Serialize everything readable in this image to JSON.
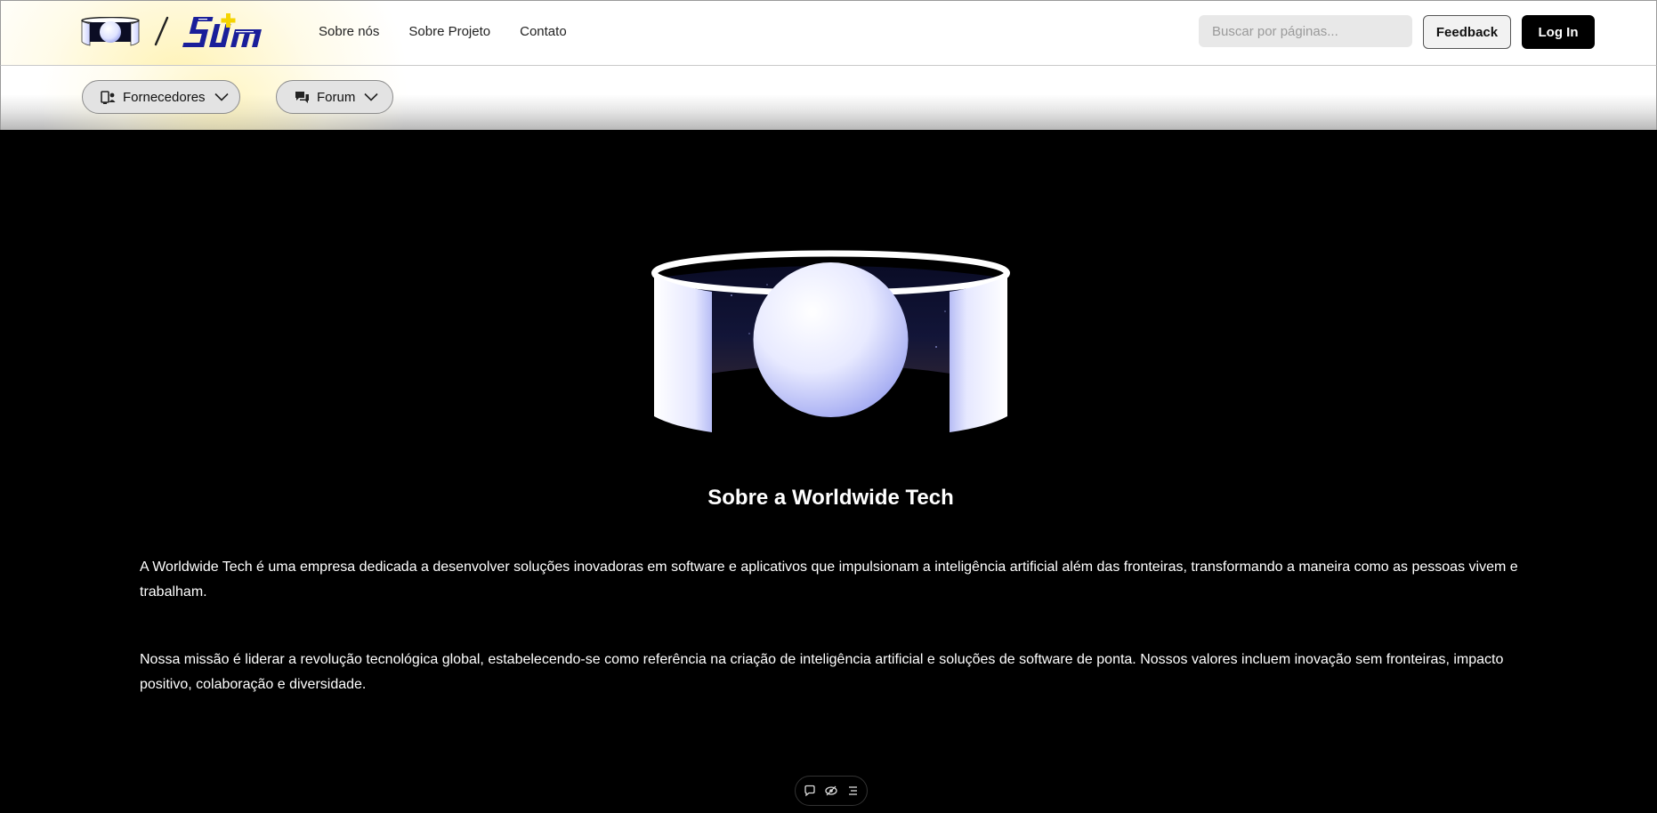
{
  "header": {
    "brand_logo": "worldwide-tech-logo",
    "sum_logo_text": "SUM",
    "nav": [
      "Sobre nós",
      "Sobre Projeto",
      "Contato"
    ],
    "search_placeholder": "Buscar por páginas...",
    "feedback_label": "Feedback",
    "login_label": "Log In"
  },
  "subnav": {
    "fornecedores_label": "Fornecedores",
    "fornecedores_icon": "person-monitor-icon",
    "forum_label": "Forum",
    "forum_icon": "chat-bubbles-icon"
  },
  "main": {
    "title": "Sobre a Worldwide Tech",
    "paragraph_1": "A Worldwide Tech é uma empresa dedicada a desenvolver soluções inovadoras em software e aplicativos que impulsionam a inteligência artificial além das fronteiras, transformando a maneira como as pessoas vivem e trabalham.",
    "paragraph_2": "Nossa missão é liderar a revolução tecnológica global, estabelecendo-se como referência na criação de inteligência artificial e soluções de software de ponta. Nossos valores incluem inovação sem fronteiras, impacto positivo, colaboração e diversidade."
  },
  "toolbar": {
    "icons": [
      "comment-icon",
      "eye-toggle-icon",
      "list-icon"
    ]
  },
  "colors": {
    "page_bg": "#000000",
    "header_bg": "#ffffff",
    "header_glow": "#ffec8c",
    "logo_blue": "#1a1f9a",
    "logo_yellow": "#f5d400",
    "login_bg": "#000000"
  }
}
